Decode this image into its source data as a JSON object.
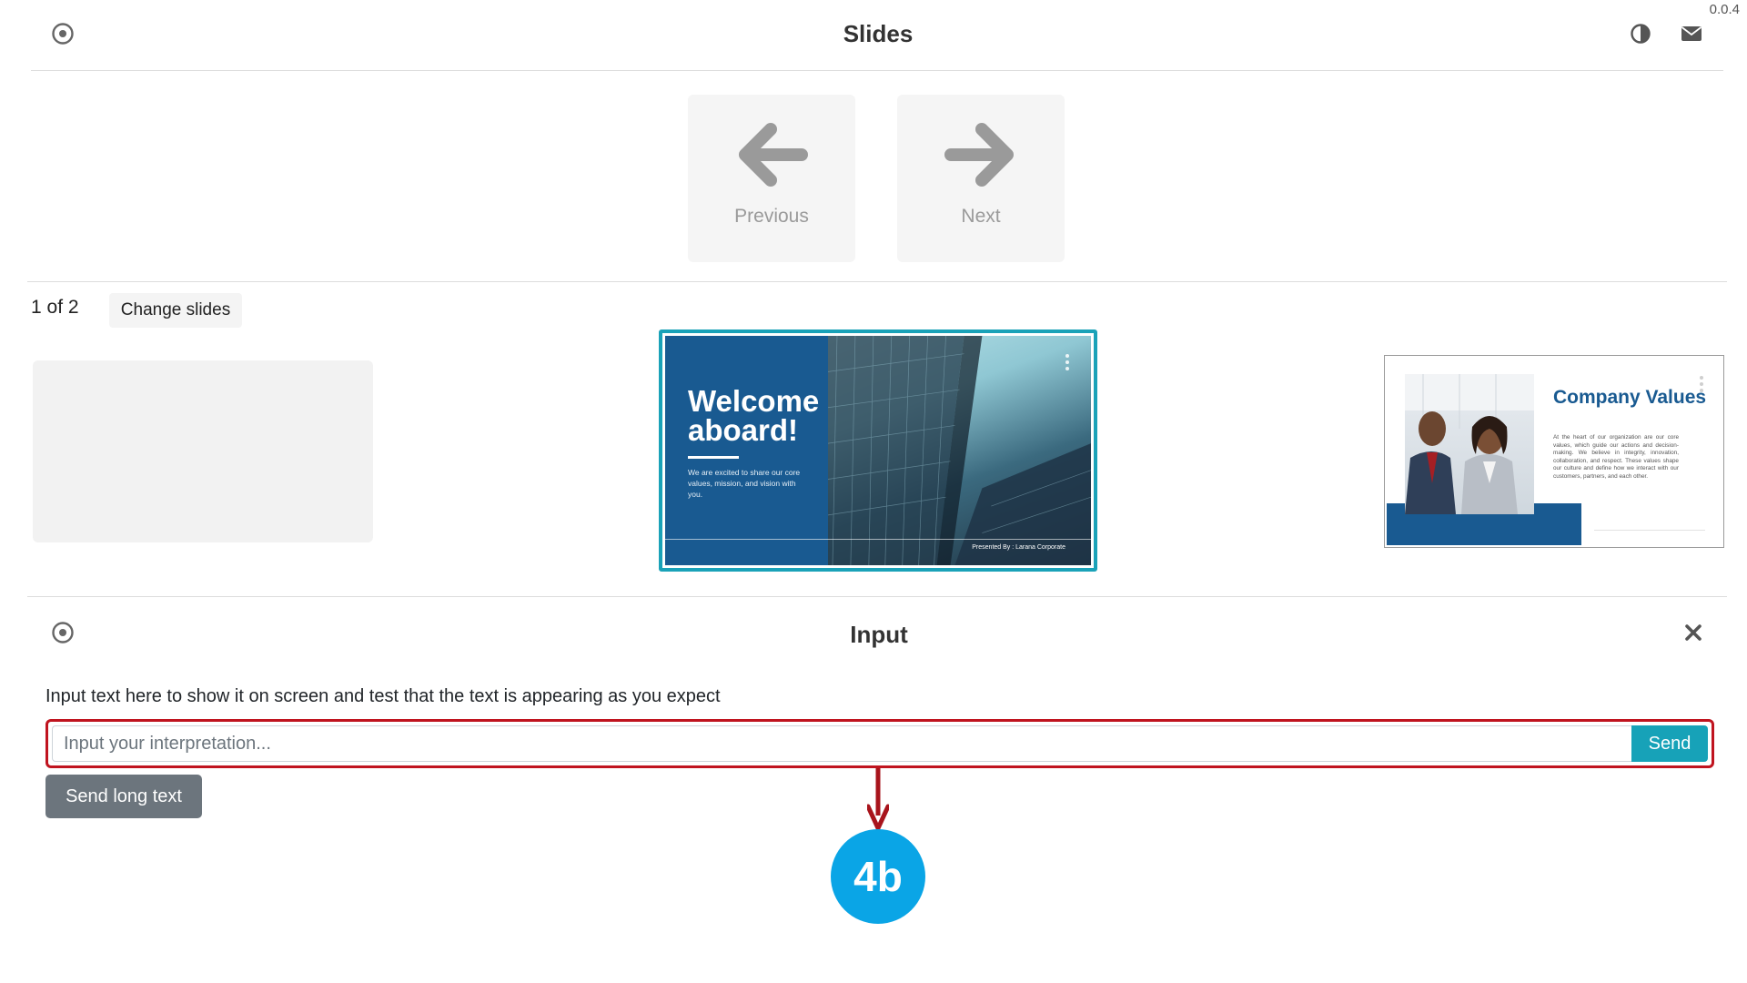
{
  "app": {
    "version": "0.0.4",
    "title": "Slides"
  },
  "header": {
    "left_icon": "radio-dot-icon",
    "right_icons": [
      "contrast-icon",
      "envelope-icon"
    ]
  },
  "navigation": {
    "previous_label": "Previous",
    "next_label": "Next"
  },
  "slides": {
    "counter": "1 of 2",
    "change_label": "Change slides",
    "current": {
      "title": "Welcome aboard!",
      "subtitle": "We are excited to share our core values, mission, and vision with you.",
      "footer": "Presented By : Larana Corporate"
    },
    "next": {
      "title": "Company Values",
      "body": "At the heart of our organization are our core values, which guide our actions and decision-making. We believe in integrity, innovation, collaboration, and respect. These values shape our culture and define how we interact with our customers, partners, and each other."
    }
  },
  "input_panel": {
    "title": "Input",
    "instruction": "Input text here to show it on screen and test that the text is appearing as you expect",
    "placeholder": "Input your interpretation...",
    "value": "",
    "send_label": "Send",
    "send_long_label": "Send long text"
  },
  "annotation": {
    "badge": "4b"
  },
  "colors": {
    "accent": "#17a2b8",
    "highlight": "#c0141f",
    "badge": "#0aa5e6",
    "slide_blue": "#195a91",
    "secondary_button": "#6c757d"
  }
}
